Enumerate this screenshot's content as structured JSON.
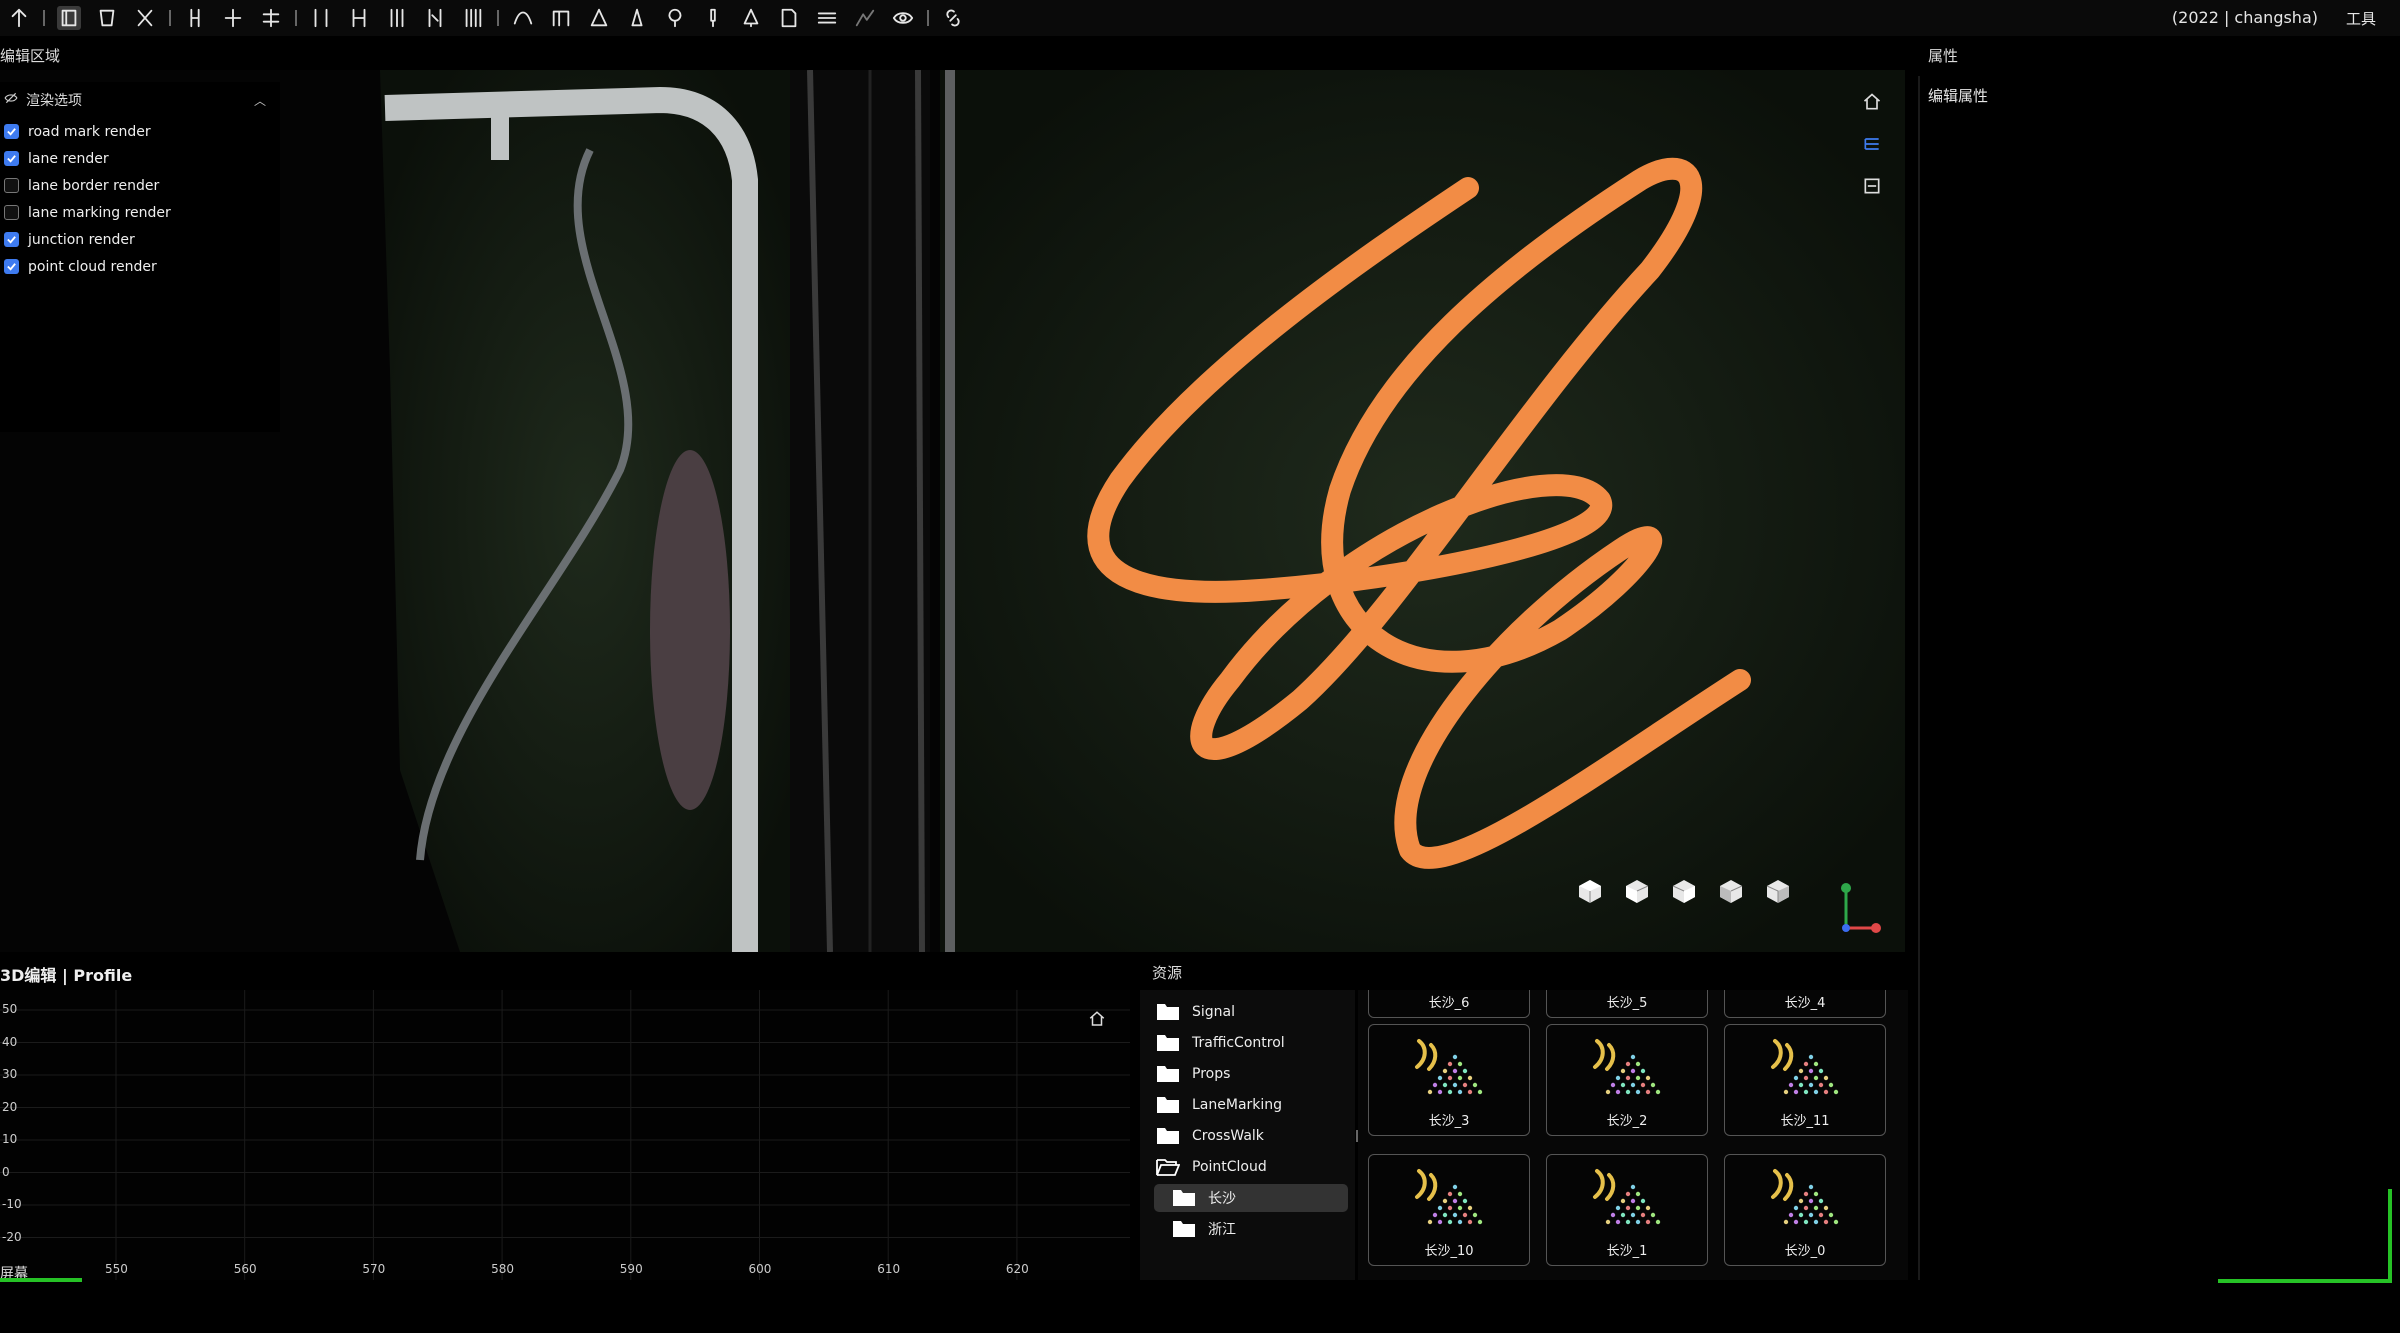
{
  "window": {
    "project_label": "(2022 | changsha)",
    "tools_menu": "工具"
  },
  "editor": {
    "title": "编辑区域",
    "render_options": {
      "header": "渲染选项",
      "items": [
        {
          "label": "road mark render",
          "checked": true
        },
        {
          "label": "lane render",
          "checked": true
        },
        {
          "label": "lane border render",
          "checked": false
        },
        {
          "label": "lane marking render",
          "checked": false
        },
        {
          "label": "junction render",
          "checked": true
        },
        {
          "label": "point cloud render",
          "checked": true
        }
      ]
    }
  },
  "properties": {
    "title": "属性",
    "subtitle": "编辑属性"
  },
  "profile": {
    "title": "3D编辑 | Profile",
    "y_ticks": [
      "50",
      "40",
      "30",
      "20",
      "10",
      "0",
      "-10",
      "-20"
    ],
    "x_ticks": [
      "550",
      "560",
      "570",
      "580",
      "590",
      "600",
      "610",
      "620"
    ],
    "screen_label": "屏幕"
  },
  "resources": {
    "title": "资源",
    "tree": [
      {
        "label": "Signal",
        "level": 0,
        "open": false,
        "selected": false
      },
      {
        "label": "TrafficControl",
        "level": 0,
        "open": false,
        "selected": false
      },
      {
        "label": "Props",
        "level": 0,
        "open": false,
        "selected": false
      },
      {
        "label": "LaneMarking",
        "level": 0,
        "open": false,
        "selected": false
      },
      {
        "label": "CrossWalk",
        "level": 0,
        "open": false,
        "selected": false
      },
      {
        "label": "PointCloud",
        "level": 0,
        "open": true,
        "selected": false
      },
      {
        "label": "长沙",
        "level": 1,
        "open": false,
        "selected": true
      },
      {
        "label": "浙江",
        "level": 1,
        "open": false,
        "selected": false
      }
    ],
    "partial_cards": [
      "长沙_6",
      "长沙_5",
      "长沙_4"
    ],
    "cards": [
      "长沙_3",
      "长沙_2",
      "长沙_11",
      "长沙_10",
      "长沙_1",
      "长沙_0"
    ]
  },
  "icons": {
    "toolbar": [
      "arrow-icon",
      "road-select-icon",
      "road-add-icon",
      "road-delete-icon",
      "lane-icon",
      "lane-split-icon",
      "lane-merge-icon",
      "lane-width-icon",
      "lane-add-icon",
      "lane-insert-icon",
      "lane-remove-icon",
      "lane-stripe-icon",
      "curve-icon",
      "portal-icon",
      "pedestrian-icon",
      "cone-icon",
      "sign-icon",
      "light-icon",
      "tree-icon",
      "document-edit-icon",
      "road-section-icon",
      "terrain-icon",
      "eye-icon",
      "link-icon"
    ],
    "viewport": [
      "home-icon",
      "perspective-icon",
      "ortho-icon"
    ]
  },
  "colors": {
    "accent": "#3e7bf0",
    "annotation": "#f28c45",
    "progress": "#26c226"
  }
}
